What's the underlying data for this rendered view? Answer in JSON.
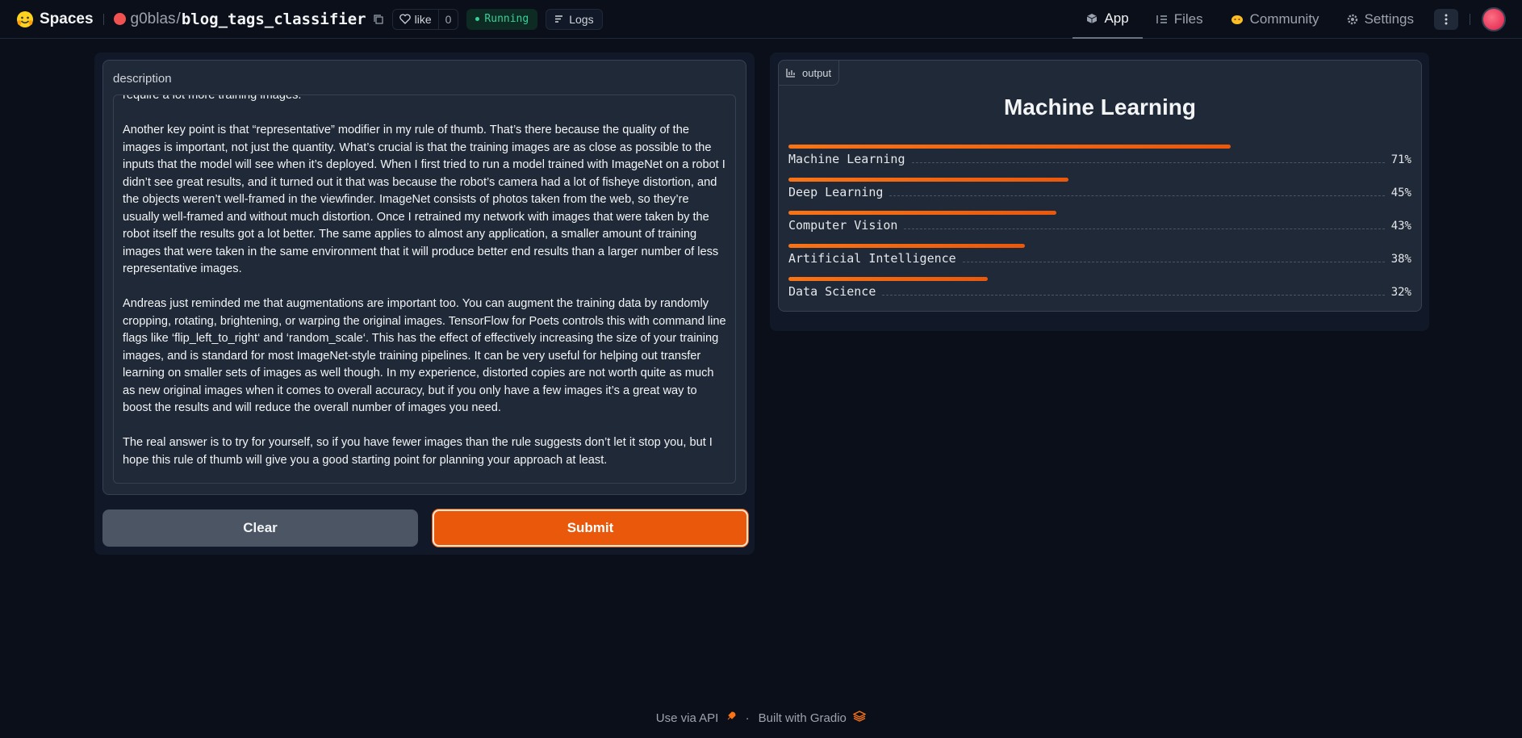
{
  "header": {
    "brand": "Spaces",
    "owner": "g0blas",
    "repo": "blog_tags_classifier",
    "like_label": "like",
    "like_count": "0",
    "status": "Running",
    "logs_label": "Logs",
    "nav": [
      {
        "label": "App",
        "icon": "cube-icon",
        "active": true
      },
      {
        "label": "Files",
        "icon": "files-icon",
        "active": false
      },
      {
        "label": "Community",
        "icon": "community-icon",
        "active": false
      },
      {
        "label": "Settings",
        "icon": "gear-icon",
        "active": false
      }
    ],
    "more_icon": "more-vertical-icon"
  },
  "input": {
    "label": "description",
    "paragraphs": [
      "require a lot more training images.",
      "Another key point is that “representative” modifier in my rule of thumb. That’s there because the quality of the images is important, not just the quantity. What’s crucial is that the training images are as close as possible to the inputs that the model will see when it’s deployed. When I first tried to run a model trained with ImageNet on a robot I didn’t see great results, and it turned out it that was because the robot’s camera had a lot of fisheye distortion, and the objects weren’t well-framed in the viewfinder. ImageNet consists of photos taken from the web, so they’re usually well-framed and without much distortion. Once I retrained my network with images that were taken by the robot itself the results got a lot better. The same applies to almost any application, a smaller amount of training images that were taken in the same environment that it will produce better end results than a larger number of less representative images.",
      "Andreas just reminded me that augmentations are important too. You can augment the training data by randomly cropping, rotating, brightening, or warping the original images. TensorFlow for Poets controls this with command line flags like ‘flip_left_to_right‘ and ‘random_scale‘. This has the effect of effectively increasing the size of your training images, and is standard for most ImageNet-style training pipelines. It can be very useful for helping out transfer learning on smaller sets of images as well though. In my experience, distorted copies are not worth quite as much as new original images when it comes to overall accuracy, but if you only have a few images it’s a great way to boost the results and will reduce the overall number of images you need.",
      "The real answer is to try for yourself, so if you have fewer images than the rule suggests don’t let it stop you, but I hope this rule of thumb will give you a good starting point for planning your approach at least."
    ]
  },
  "buttons": {
    "clear": "Clear",
    "submit": "Submit"
  },
  "output": {
    "tag": "output",
    "title": "Machine Learning",
    "confidences": [
      {
        "label": "Machine Learning",
        "value": 0.71,
        "pct": "71%"
      },
      {
        "label": "Deep Learning",
        "value": 0.45,
        "pct": "45%"
      },
      {
        "label": "Computer Vision",
        "value": 0.43,
        "pct": "43%"
      },
      {
        "label": "Artificial Intelligence",
        "value": 0.38,
        "pct": "38%"
      },
      {
        "label": "Data Science",
        "value": 0.32,
        "pct": "32%"
      }
    ]
  },
  "footer": {
    "api": "Use via API",
    "dot": "·",
    "built": "Built with Gradio"
  },
  "colors": {
    "accent": "#ea580c",
    "background": "#0b0f19",
    "running": "#34d399"
  }
}
